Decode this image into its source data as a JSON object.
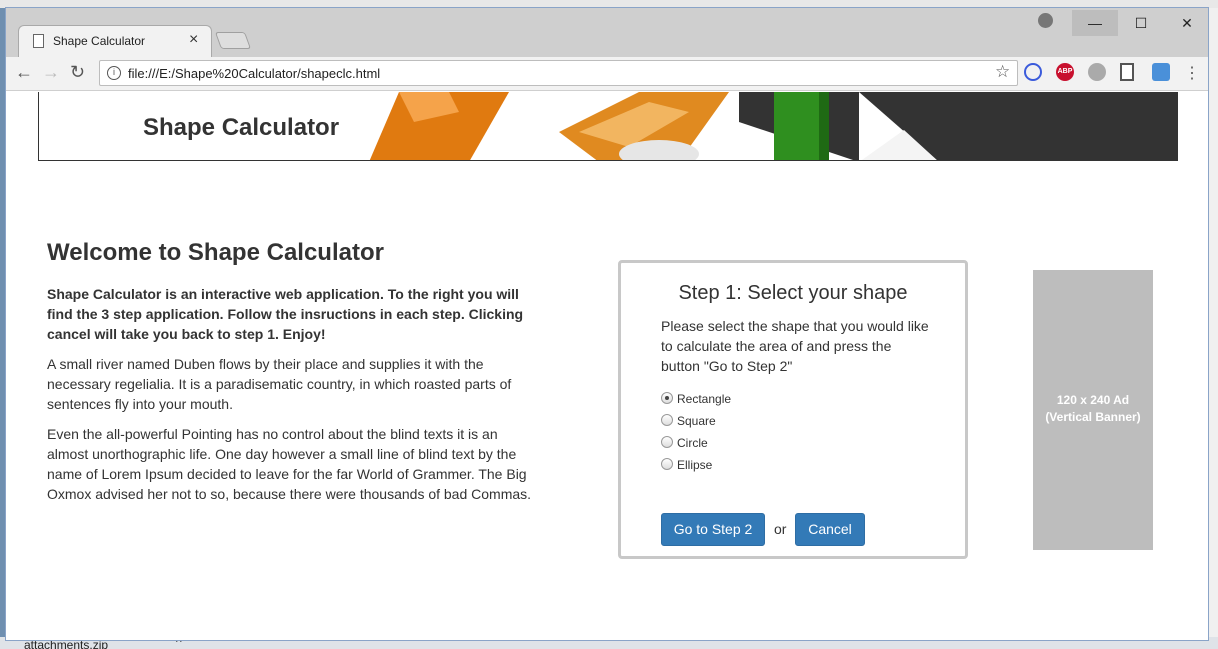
{
  "browser": {
    "tab_title": "Shape Calculator",
    "tab_close": "×",
    "url": "file:///E:/Shape%20Calculator/shapeclc.html",
    "window_controls": {
      "minimize": "—",
      "maximize": "☐",
      "close": "✕"
    },
    "nav": {
      "back": "←",
      "forward": "→",
      "reload": "↻"
    },
    "bookmark_star": "☆",
    "menu": "⋮",
    "extensions": [
      "block-icon",
      "adblock-icon",
      "globe-icon",
      "bookmark-icon",
      "translate-icon"
    ],
    "abp_label": "ABP"
  },
  "desktop": {
    "bottom_file": "attachments.zip",
    "bottom_chevron": "^"
  },
  "page": {
    "banner_title": "Shape Calculator",
    "intro": {
      "heading": "Welcome to Shape Calculator",
      "lead": "Shape Calculator is an interactive web application. To the right you will find the 3 step application. Follow the insructions in each step. Clicking cancel will take you back to step 1. Enjoy!",
      "p1": "A small river named Duben flows by their place and supplies it with the necessary regelialia. It is a paradisematic country, in which roasted parts of sentences fly into your mouth.",
      "p2": "Even the all-powerful Pointing has no control about the blind texts it is an almost unorthographic life. One day however a small line of blind text by the name of Lorem Ipsum decided to leave for the far World of Grammer. The Big Oxmox advised her not to so, because there were thousands of bad Commas."
    },
    "step": {
      "title": "Step 1: Select your shape",
      "instructions": "Please select the shape that you would like to calculate the area of and press the button \"Go to Step 2\"",
      "options": [
        "Rectangle",
        "Square",
        "Circle",
        "Ellipse"
      ],
      "selected": "Rectangle",
      "next_button": "Go to Step 2",
      "or_text": "or",
      "cancel_button": "Cancel"
    },
    "ad": {
      "line1": "120 x 240 Ad",
      "line2": "(Vertical Banner)"
    }
  },
  "colors": {
    "primary_button": "#337ab7",
    "ad_background": "#bdbdbd",
    "panel_border": "#c8c8c8"
  }
}
